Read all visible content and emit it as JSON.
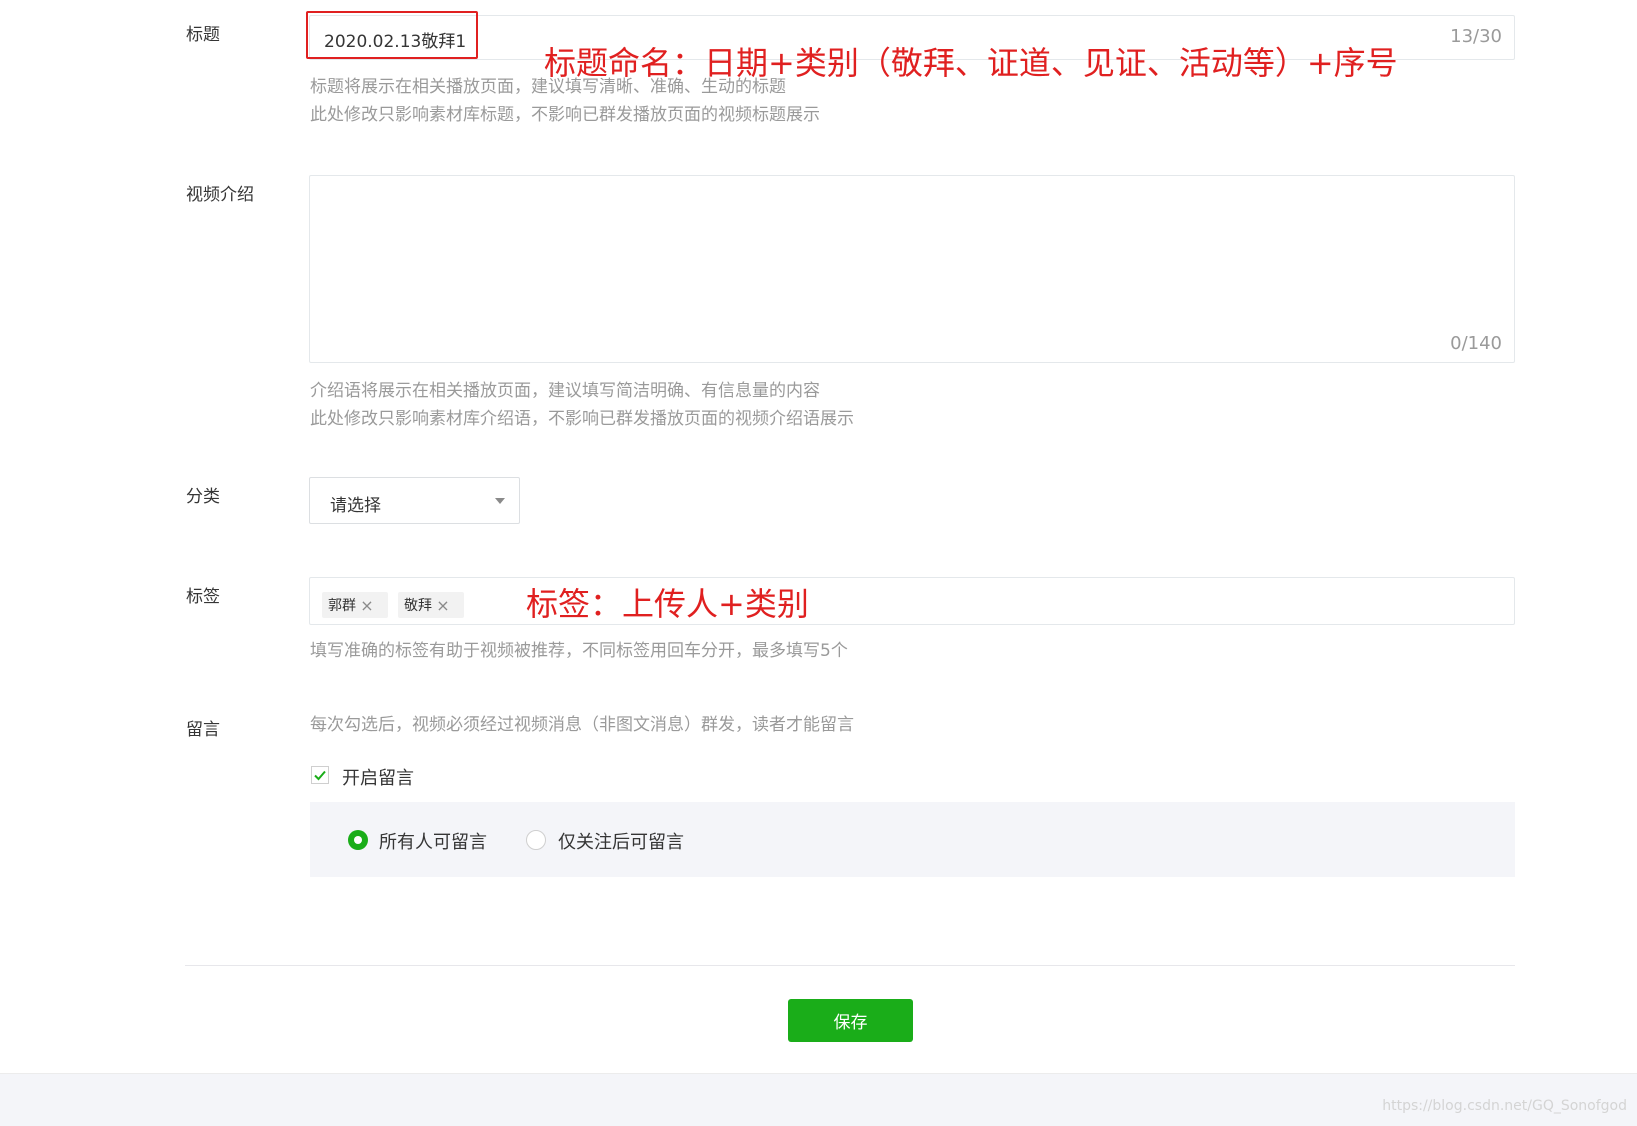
{
  "title": {
    "label": "标题",
    "value": "2020.02.13敬拜1",
    "counter": "13/30",
    "help": [
      "标题将展示在相关播放页面，建议填写清晰、准确、生动的标题",
      "此处修改只影响素材库标题，不影响已群发播放页面的视频标题展示"
    ],
    "annotation": "标题命名：日期+类别（敬拜、证道、见证、活动等）+序号"
  },
  "intro": {
    "label": "视频介绍",
    "value": "",
    "counter": "0/140",
    "help": [
      "介绍语将展示在相关播放页面，建议填写简洁明确、有信息量的内容",
      "此处修改只影响素材库介绍语，不影响已群发播放页面的视频介绍语展示"
    ]
  },
  "category": {
    "label": "分类",
    "selected": "请选择"
  },
  "tags": {
    "label": "标签",
    "items": [
      "郭群",
      "敬拜"
    ],
    "help": "填写准确的标签有助于视频被推荐，不同标签用回车分开，最多填写5个",
    "annotation": "标签：上传人+类别"
  },
  "comments": {
    "label": "留言",
    "note": "每次勾选后，视频必须经过视频消息（非图文消息）群发，读者才能留言",
    "enable_label": "开启留言",
    "enabled": true,
    "options": [
      "所有人可留言",
      "仅关注后可留言"
    ],
    "selected_index": 0
  },
  "save_button": "保存",
  "watermark": "https://blog.csdn.net/GQ_Sonofgod",
  "colors": {
    "accent": "#1aad19",
    "annotation": "#e02020",
    "border": "#e4e8eb",
    "help": "#9a9a9a"
  }
}
